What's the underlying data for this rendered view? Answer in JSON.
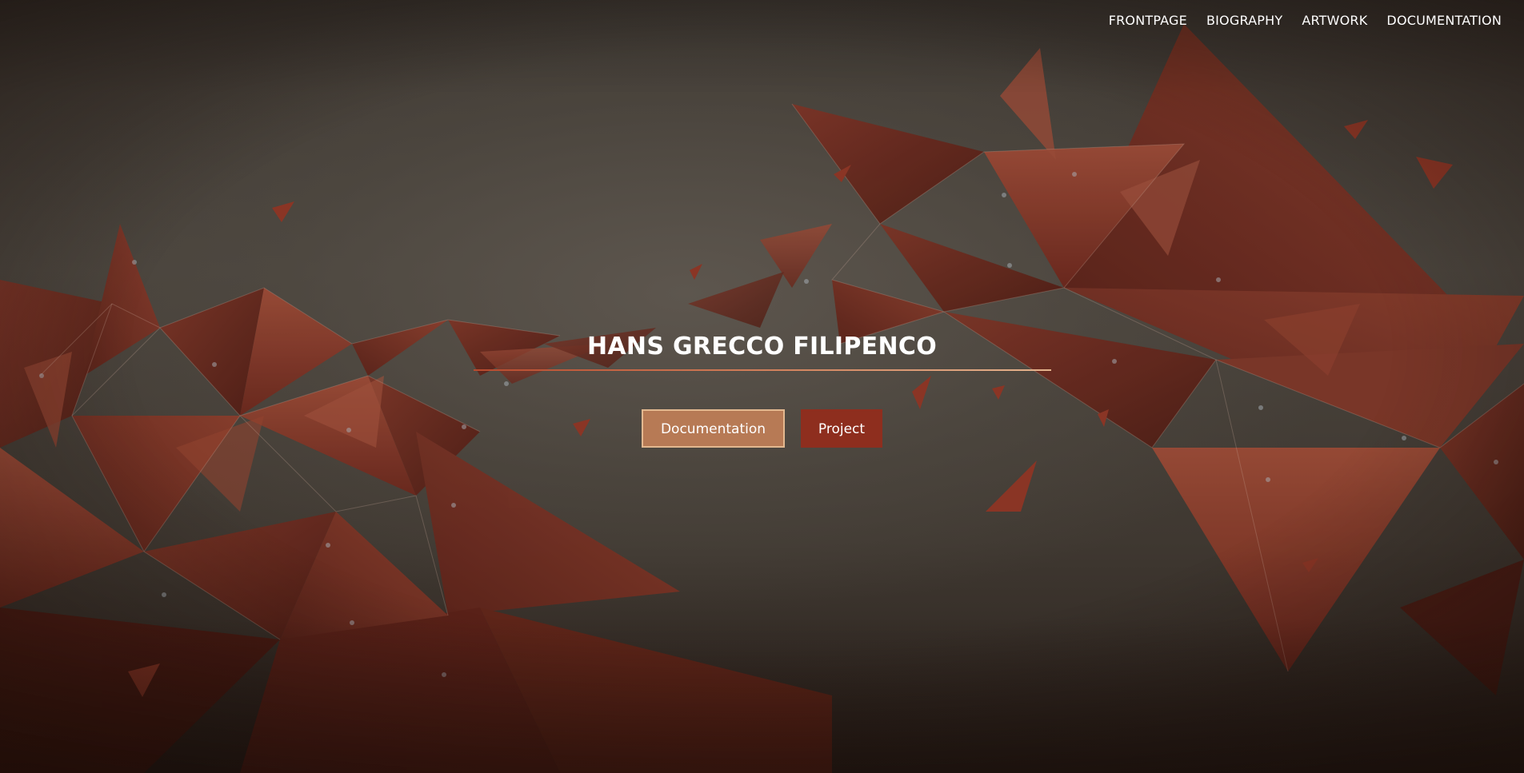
{
  "nav": {
    "items": [
      {
        "label": "FRONTPAGE"
      },
      {
        "label": "BIOGRAPHY"
      },
      {
        "label": "ARTWORK"
      },
      {
        "label": "DOCUMENTATION"
      }
    ]
  },
  "hero": {
    "title": "HANS GRECCO FILIPENCO",
    "primary_button": "Documentation",
    "secondary_button": "Project"
  },
  "colors": {
    "accent_primary": "#b77a55",
    "accent_secondary": "#8e2e1e",
    "rule_start": "#b84a2e",
    "rule_end": "#e5b48e",
    "shard": "#6e2b20"
  },
  "background": {
    "icon": "low-poly-shards-artwork"
  }
}
